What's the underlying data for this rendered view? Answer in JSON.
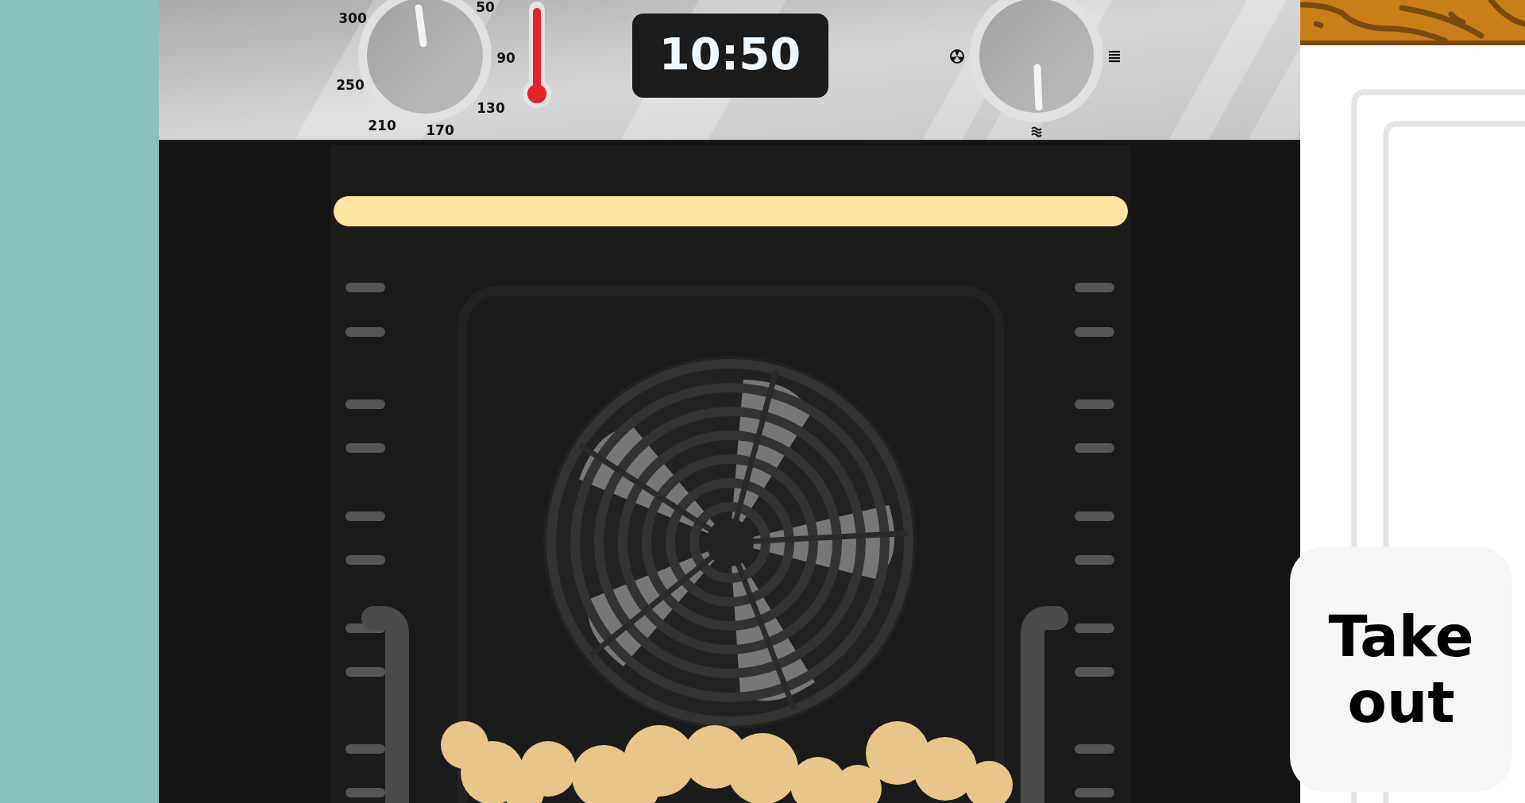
{
  "temperature_dial": {
    "labels": [
      "300",
      "50",
      "90",
      "250",
      "130",
      "210",
      "170"
    ]
  },
  "thermometer": {
    "level": 1
  },
  "clock": {
    "time": "10:50"
  },
  "take_out_button": {
    "label": "Take out"
  }
}
